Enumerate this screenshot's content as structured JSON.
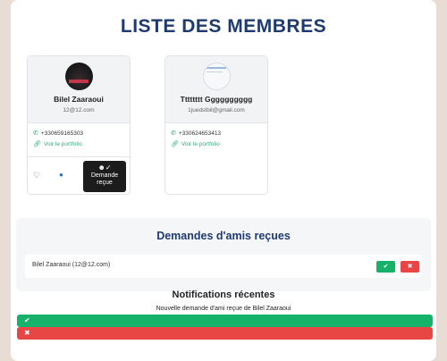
{
  "page": {
    "title": "LISTE DES MEMBRES"
  },
  "members": [
    {
      "name": "Bilel Zaaraoui",
      "email": "12@12.com",
      "phone": "+330659165303",
      "portfolio_label": "Voir le portfolio",
      "request_label": "Demande reçue"
    },
    {
      "name": "Tttttttt Gggggggggg",
      "email": "1juedstbil@gmail.com",
      "phone": "+330624653413",
      "portfolio_label": "Voir le portfolio"
    }
  ],
  "friend_requests": {
    "title": "Demandes d'amis reçues",
    "items": [
      {
        "text": "Bilel Zaaraoui (12@12.com)"
      }
    ]
  },
  "notifications": {
    "title": "Notifications récentes",
    "message": "Nouvelle demande d'ami reçue de Bilel Zaaraoui"
  },
  "icons": {
    "phone": "phone-icon",
    "link": "link-icon",
    "heart": "heart-icon",
    "message": "message-icon",
    "user_check": "user-check-icon",
    "check": "check-icon",
    "close": "close-icon"
  },
  "colors": {
    "title": "#1e3a6e",
    "accept": "#17b26a",
    "reject": "#e84545",
    "link": "#2fae7a",
    "request_button": "#1c1c1c"
  }
}
